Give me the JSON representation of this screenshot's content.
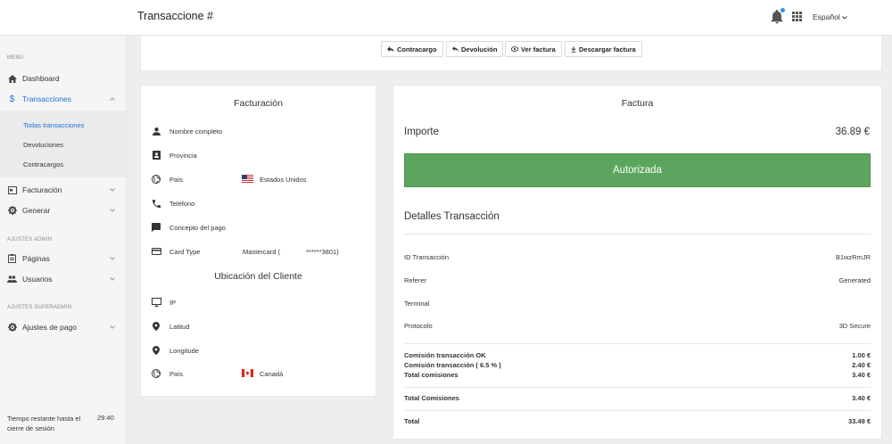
{
  "header": {
    "title": "Transaccione #",
    "language": "Español"
  },
  "sidebar": {
    "section_menu": "MENÚ",
    "dashboard": "Dashboard",
    "transacciones": "Transacciones",
    "sub_items": [
      "Todas transacciones",
      "Devoluciones",
      "Contracargos"
    ],
    "facturacion": "Facturación",
    "generar": "Generar",
    "section_admin": "AJUSTES ADMIN",
    "paginas": "Páginas",
    "usuarios": "Usuarios",
    "section_superadmin": "AJUSTES SUPERADMIN",
    "ajustes_pago": "Ajustes de pago",
    "session_label": "Tiempo restante hasta el cierre de sesión",
    "session_time": "29:40"
  },
  "toolbar": {
    "contracargo": "Contracargo",
    "devolucion": "Devolución",
    "ver_factura": "Ver factura",
    "descargar_factura": "Descargar factura"
  },
  "billing": {
    "title": "Facturación",
    "nombre": "Nombre completo",
    "provincia": "Provincia",
    "pais": "País",
    "pais_value": "Estados Unidos",
    "telefono": "Teléfono",
    "concepto": "Concepto del pago",
    "card_type": "Card Type",
    "card_brand": "Mastercard (",
    "card_number": "******3801)",
    "location_title": "Ubicación del Cliente",
    "ip": "IP",
    "latitud": "Latitud",
    "longitud": "Longitude",
    "pais2": "País",
    "pais2_value": "Canadá"
  },
  "invoice": {
    "title": "Factura",
    "amount_label": "Importe",
    "amount_value": "36.89 €",
    "status": "Autorizada",
    "details_title": "Detalles Transacción",
    "rows": [
      {
        "label": "ID Transacción",
        "value": "B1wzRmJR"
      },
      {
        "label": "Referer",
        "value": "Generated"
      },
      {
        "label": "Terminal",
        "value": ""
      },
      {
        "label": "Protocolo",
        "value": "3D Secure"
      }
    ],
    "fees": [
      {
        "label": "Comisión transacción OK",
        "value": "1.00 €"
      },
      {
        "label": "Comisión transacción ( 6.5 % )",
        "value": "2.40 €"
      },
      {
        "label": "Total comisiones",
        "value": "3.40 €"
      }
    ],
    "total_comisiones_label": "Total Comisiones",
    "total_comisiones_value": "3.40 €",
    "total_label": "Total",
    "total_value": "33.49 €"
  },
  "colors": {
    "accent": "#1e6fd9",
    "success": "#5ba55e",
    "notification_dot": "#2196f3"
  }
}
